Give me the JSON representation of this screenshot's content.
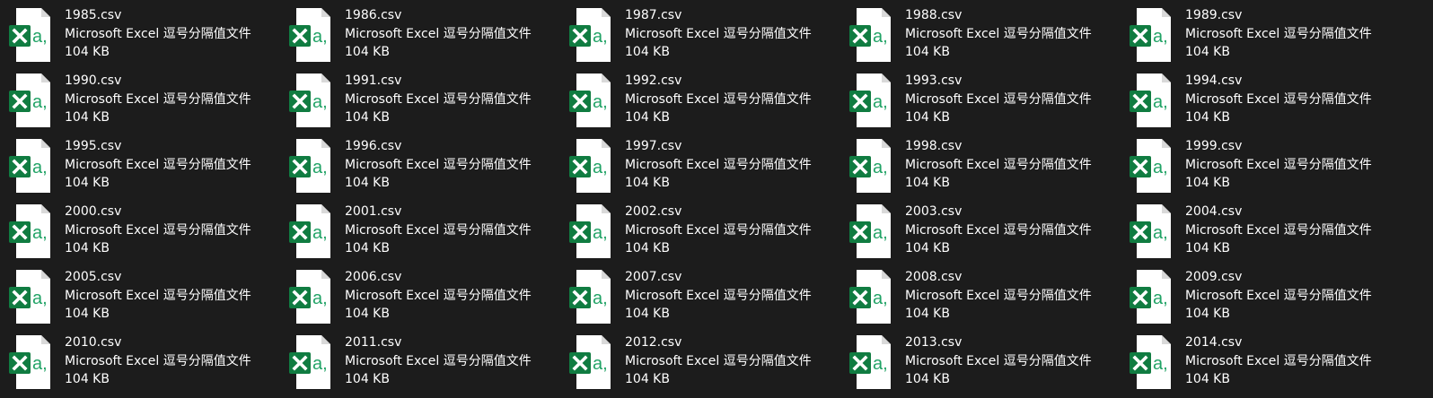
{
  "icon": "excel-csv-icon",
  "icon_colors": {
    "page": "#ffffff",
    "page_fold": "#d9d9d9",
    "badge": "#107c41",
    "badge_text": "#ffffff",
    "glyph": "#21a366"
  },
  "files": [
    {
      "name": "1985.csv",
      "type": "Microsoft Excel 逗号分隔值文件",
      "size": "104 KB"
    },
    {
      "name": "1986.csv",
      "type": "Microsoft Excel 逗号分隔值文件",
      "size": "104 KB"
    },
    {
      "name": "1987.csv",
      "type": "Microsoft Excel 逗号分隔值文件",
      "size": "104 KB"
    },
    {
      "name": "1988.csv",
      "type": "Microsoft Excel 逗号分隔值文件",
      "size": "104 KB"
    },
    {
      "name": "1989.csv",
      "type": "Microsoft Excel 逗号分隔值文件",
      "size": "104 KB"
    },
    {
      "name": "1990.csv",
      "type": "Microsoft Excel 逗号分隔值文件",
      "size": "104 KB"
    },
    {
      "name": "1991.csv",
      "type": "Microsoft Excel 逗号分隔值文件",
      "size": "104 KB"
    },
    {
      "name": "1992.csv",
      "type": "Microsoft Excel 逗号分隔值文件",
      "size": "104 KB"
    },
    {
      "name": "1993.csv",
      "type": "Microsoft Excel 逗号分隔值文件",
      "size": "104 KB"
    },
    {
      "name": "1994.csv",
      "type": "Microsoft Excel 逗号分隔值文件",
      "size": "104 KB"
    },
    {
      "name": "1995.csv",
      "type": "Microsoft Excel 逗号分隔值文件",
      "size": "104 KB"
    },
    {
      "name": "1996.csv",
      "type": "Microsoft Excel 逗号分隔值文件",
      "size": "104 KB"
    },
    {
      "name": "1997.csv",
      "type": "Microsoft Excel 逗号分隔值文件",
      "size": "104 KB"
    },
    {
      "name": "1998.csv",
      "type": "Microsoft Excel 逗号分隔值文件",
      "size": "104 KB"
    },
    {
      "name": "1999.csv",
      "type": "Microsoft Excel 逗号分隔值文件",
      "size": "104 KB"
    },
    {
      "name": "2000.csv",
      "type": "Microsoft Excel 逗号分隔值文件",
      "size": "104 KB"
    },
    {
      "name": "2001.csv",
      "type": "Microsoft Excel 逗号分隔值文件",
      "size": "104 KB"
    },
    {
      "name": "2002.csv",
      "type": "Microsoft Excel 逗号分隔值文件",
      "size": "104 KB"
    },
    {
      "name": "2003.csv",
      "type": "Microsoft Excel 逗号分隔值文件",
      "size": "104 KB"
    },
    {
      "name": "2004.csv",
      "type": "Microsoft Excel 逗号分隔值文件",
      "size": "104 KB"
    },
    {
      "name": "2005.csv",
      "type": "Microsoft Excel 逗号分隔值文件",
      "size": "104 KB"
    },
    {
      "name": "2006.csv",
      "type": "Microsoft Excel 逗号分隔值文件",
      "size": "104 KB"
    },
    {
      "name": "2007.csv",
      "type": "Microsoft Excel 逗号分隔值文件",
      "size": "104 KB"
    },
    {
      "name": "2008.csv",
      "type": "Microsoft Excel 逗号分隔值文件",
      "size": "104 KB"
    },
    {
      "name": "2009.csv",
      "type": "Microsoft Excel 逗号分隔值文件",
      "size": "104 KB"
    },
    {
      "name": "2010.csv",
      "type": "Microsoft Excel 逗号分隔值文件",
      "size": "104 KB"
    },
    {
      "name": "2011.csv",
      "type": "Microsoft Excel 逗号分隔值文件",
      "size": "104 KB"
    },
    {
      "name": "2012.csv",
      "type": "Microsoft Excel 逗号分隔值文件",
      "size": "104 KB"
    },
    {
      "name": "2013.csv",
      "type": "Microsoft Excel 逗号分隔值文件",
      "size": "104 KB"
    },
    {
      "name": "2014.csv",
      "type": "Microsoft Excel 逗号分隔值文件",
      "size": "104 KB"
    }
  ]
}
